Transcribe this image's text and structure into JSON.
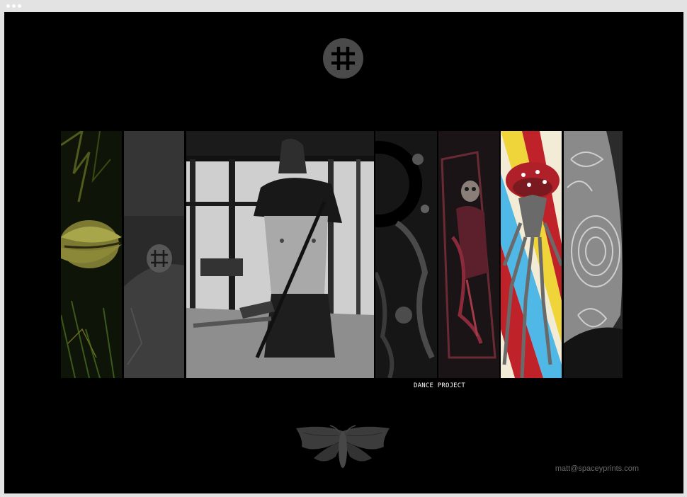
{
  "window": {
    "controls": [
      "close-dot",
      "minimize-dot",
      "maximize-dot"
    ]
  },
  "site": {
    "logo_icon": "grid-circle-icon",
    "footer_icon": "moth-icon",
    "contact_email": "matt@spaceyprints.com"
  },
  "gallery": {
    "panels": [
      {
        "id": "lips-forest",
        "label": ""
      },
      {
        "id": "masked-figure",
        "label": ""
      },
      {
        "id": "dance-project",
        "label": "DANCE PROJECT"
      },
      {
        "id": "abstract-circle",
        "label": ""
      },
      {
        "id": "red-skeleton",
        "label": ""
      },
      {
        "id": "spider-illustration",
        "label": ""
      },
      {
        "id": "damascus-blade",
        "label": ""
      }
    ],
    "active_label": "DANCE PROJECT"
  },
  "colors": {
    "background": "#000000",
    "chrome": "#e3e3e3",
    "logo": "#4a4a4a",
    "email_text": "#6a6a6a",
    "spider_red": "#c0222a",
    "spider_yellow": "#f0d53a",
    "spider_blue": "#4fb8e6"
  }
}
